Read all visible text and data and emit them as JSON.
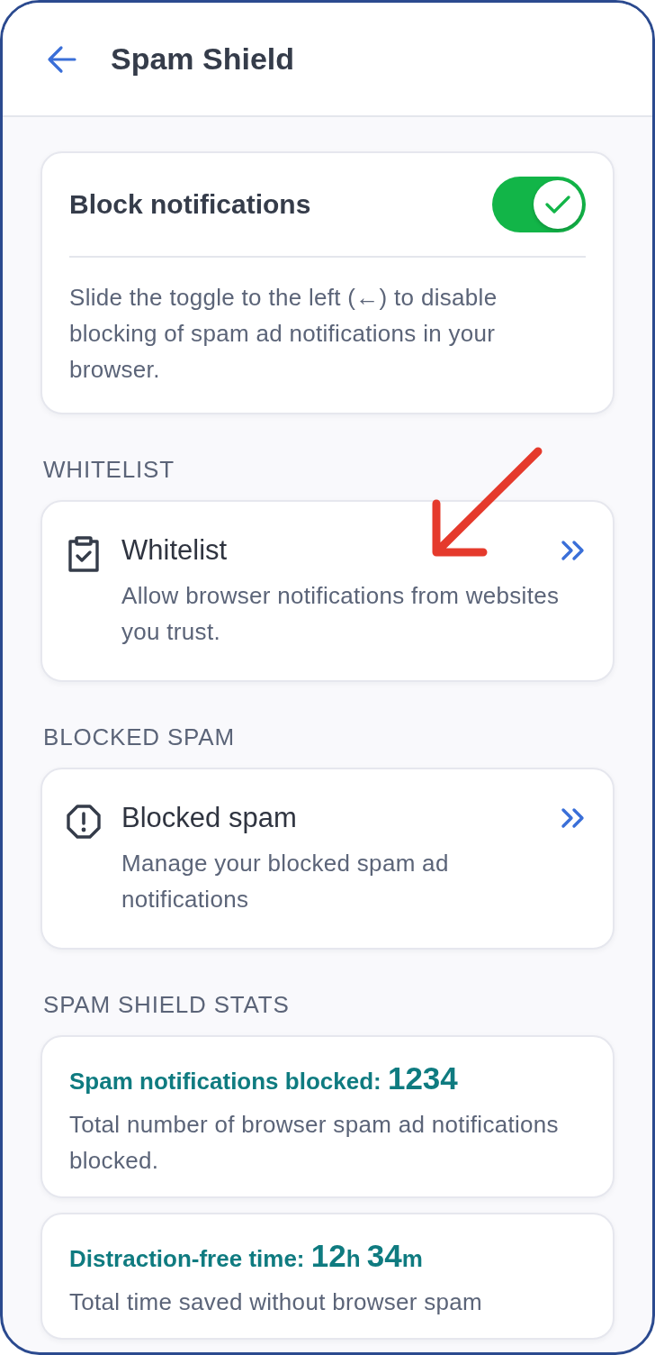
{
  "header": {
    "title": "Spam Shield"
  },
  "block_card": {
    "title": "Block notifications",
    "toggle": {
      "on": true
    },
    "description": "Slide the toggle to the left (←) to disable blocking of spam ad notifications in your browser."
  },
  "sections": [
    {
      "label": "WHITELIST",
      "items": [
        {
          "kind": "clipboard",
          "title": "Whitelist",
          "description": "Allow browser notifications from websites you trust."
        }
      ]
    },
    {
      "label": "BLOCKED SPAM",
      "items": [
        {
          "kind": "alert",
          "title": "Blocked spam",
          "description": "Manage your blocked spam ad notifications"
        }
      ]
    },
    {
      "label": "SPAM SHIELD STATS",
      "stats": [
        {
          "label": "Spam notifications blocked:",
          "value_parts": [
            {
              "kind": "number",
              "text": "1234"
            }
          ],
          "description": "Total number of browser spam ad notifications blocked."
        },
        {
          "label": "Distraction-free time:",
          "value_parts": [
            {
              "kind": "number",
              "text": "12"
            },
            {
              "kind": "unit",
              "text": "h"
            },
            {
              "kind": "number",
              "text": "34"
            },
            {
              "kind": "unit",
              "text": "m"
            }
          ],
          "description": "Total time saved without browser spam"
        }
      ]
    }
  ]
}
